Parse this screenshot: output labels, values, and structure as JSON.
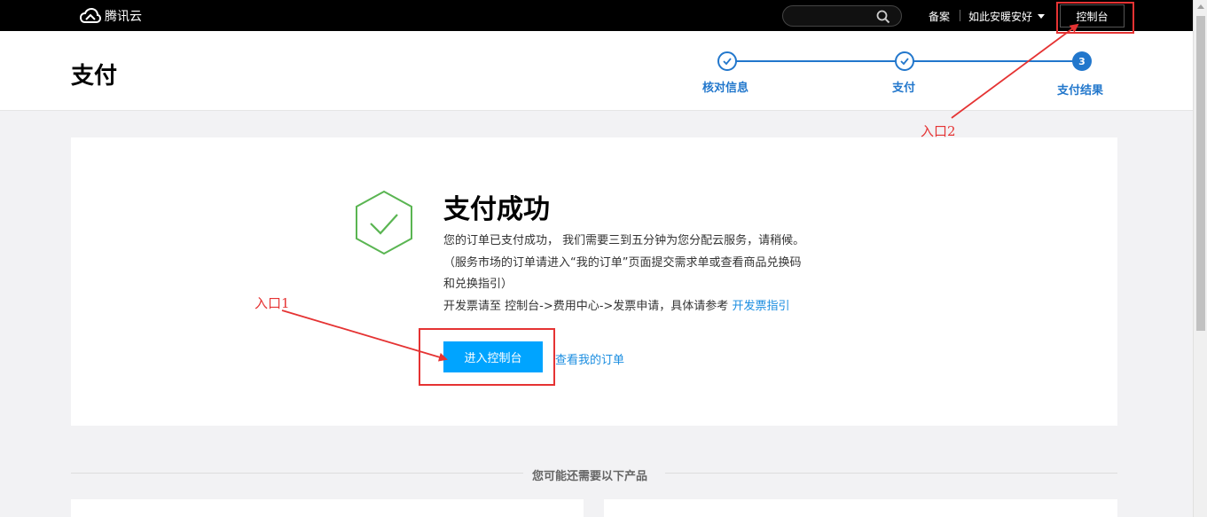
{
  "topbar": {
    "logo_text": "腾讯云",
    "search_placeholder": "",
    "beian": "备案",
    "user_name": "如此安暖安好",
    "console_button": "控制台"
  },
  "header": {
    "page_title": "支付",
    "steps": [
      {
        "label": "核对信息",
        "state": "done"
      },
      {
        "label": "支付",
        "state": "done"
      },
      {
        "label": "支付结果",
        "state": "current",
        "number": "3"
      }
    ]
  },
  "result": {
    "title": "支付成功",
    "line1": "您的订单已支付成功， 我们需要三到五分钟为您分配云服务，请稍候。",
    "line2": "（服务市场的订单请进入“我的订单”页面提交需求单或查看商品兑换码",
    "line3": "和兑换指引）",
    "line4_prefix": "开发票请至 控制台->费用中心->发票申请，具体请参考 ",
    "line4_link": "开发票指引",
    "enter_console_button": "进入控制台",
    "view_orders_link": "查看我的订单"
  },
  "recommend": {
    "title": "您可能还需要以下产品"
  },
  "annotations": {
    "entry1": "入口1",
    "entry2": "入口2"
  },
  "colors": {
    "accent": "#2277cc",
    "button": "#00a4ff",
    "success": "#5ab552",
    "annotation": "#e53333"
  },
  "icons": [
    "cloud-logo-icon",
    "search-icon",
    "caret-down-icon",
    "check-icon",
    "success-hexagon-icon"
  ]
}
